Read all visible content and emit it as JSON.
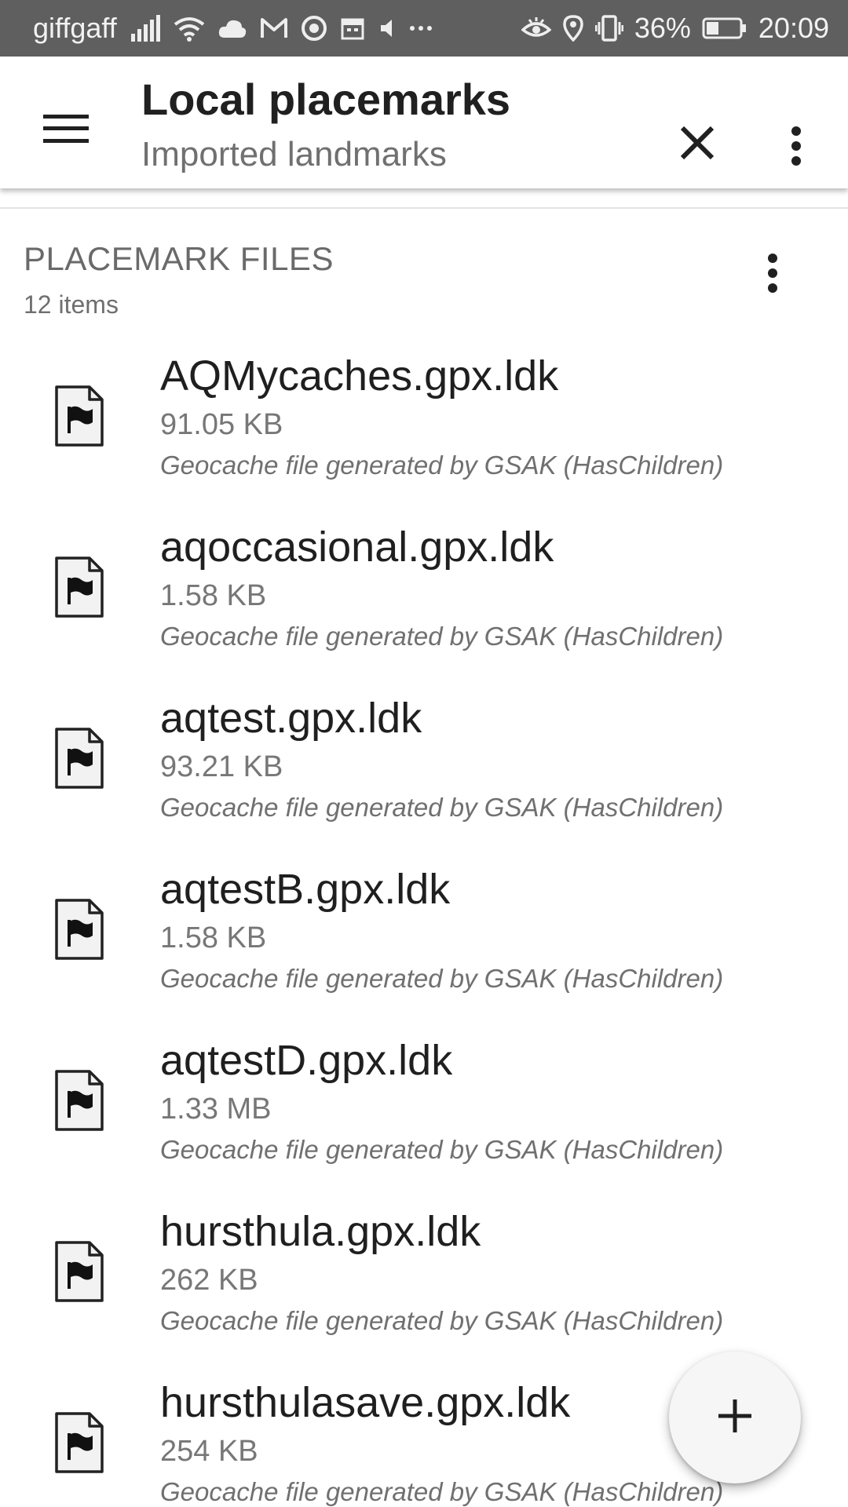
{
  "status_bar": {
    "carrier": "giffgaff",
    "battery": "36%",
    "time": "20:09",
    "icons": [
      "signal-icon",
      "wifi-icon",
      "cloud-icon",
      "gmail-icon",
      "chrome-icon",
      "calendar-icon",
      "mute-icon",
      "more-dots-icon",
      "eye-icon",
      "location-icon",
      "vibrate-icon",
      "battery-icon"
    ]
  },
  "app_bar": {
    "title": "Local placemarks",
    "subtitle": "Imported landmarks",
    "icons": [
      "menu-icon",
      "close-icon",
      "overflow-menu-icon"
    ]
  },
  "section": {
    "title": "PLACEMARK FILES",
    "count": "12 items"
  },
  "files": [
    {
      "name": "AQMycaches.gpx.ldk",
      "size": "91.05 KB",
      "description": "Geocache file generated by GSAK (HasChildren)"
    },
    {
      "name": "aqoccasional.gpx.ldk",
      "size": "1.58 KB",
      "description": "Geocache file generated by GSAK (HasChildren)"
    },
    {
      "name": "aqtest.gpx.ldk",
      "size": "93.21 KB",
      "description": "Geocache file generated by GSAK (HasChildren)"
    },
    {
      "name": "aqtestB.gpx.ldk",
      "size": "1.58 KB",
      "description": "Geocache file generated by GSAK (HasChildren)"
    },
    {
      "name": "aqtestD.gpx.ldk",
      "size": "1.33 MB",
      "description": "Geocache file generated by GSAK (HasChildren)"
    },
    {
      "name": "hursthula.gpx.ldk",
      "size": "262 KB",
      "description": "Geocache file generated by GSAK (HasChildren)"
    },
    {
      "name": "hursthulasave.gpx.ldk",
      "size": "254 KB",
      "description": "Geocache file generated by GSAK (HasChildren)"
    }
  ],
  "fab": {
    "icon": "add-icon"
  },
  "colors": {
    "status_bar": "#5f5f5f",
    "app_bar": "#ffffff",
    "text_primary": "#1f1f1f",
    "text_secondary": "#707070"
  }
}
